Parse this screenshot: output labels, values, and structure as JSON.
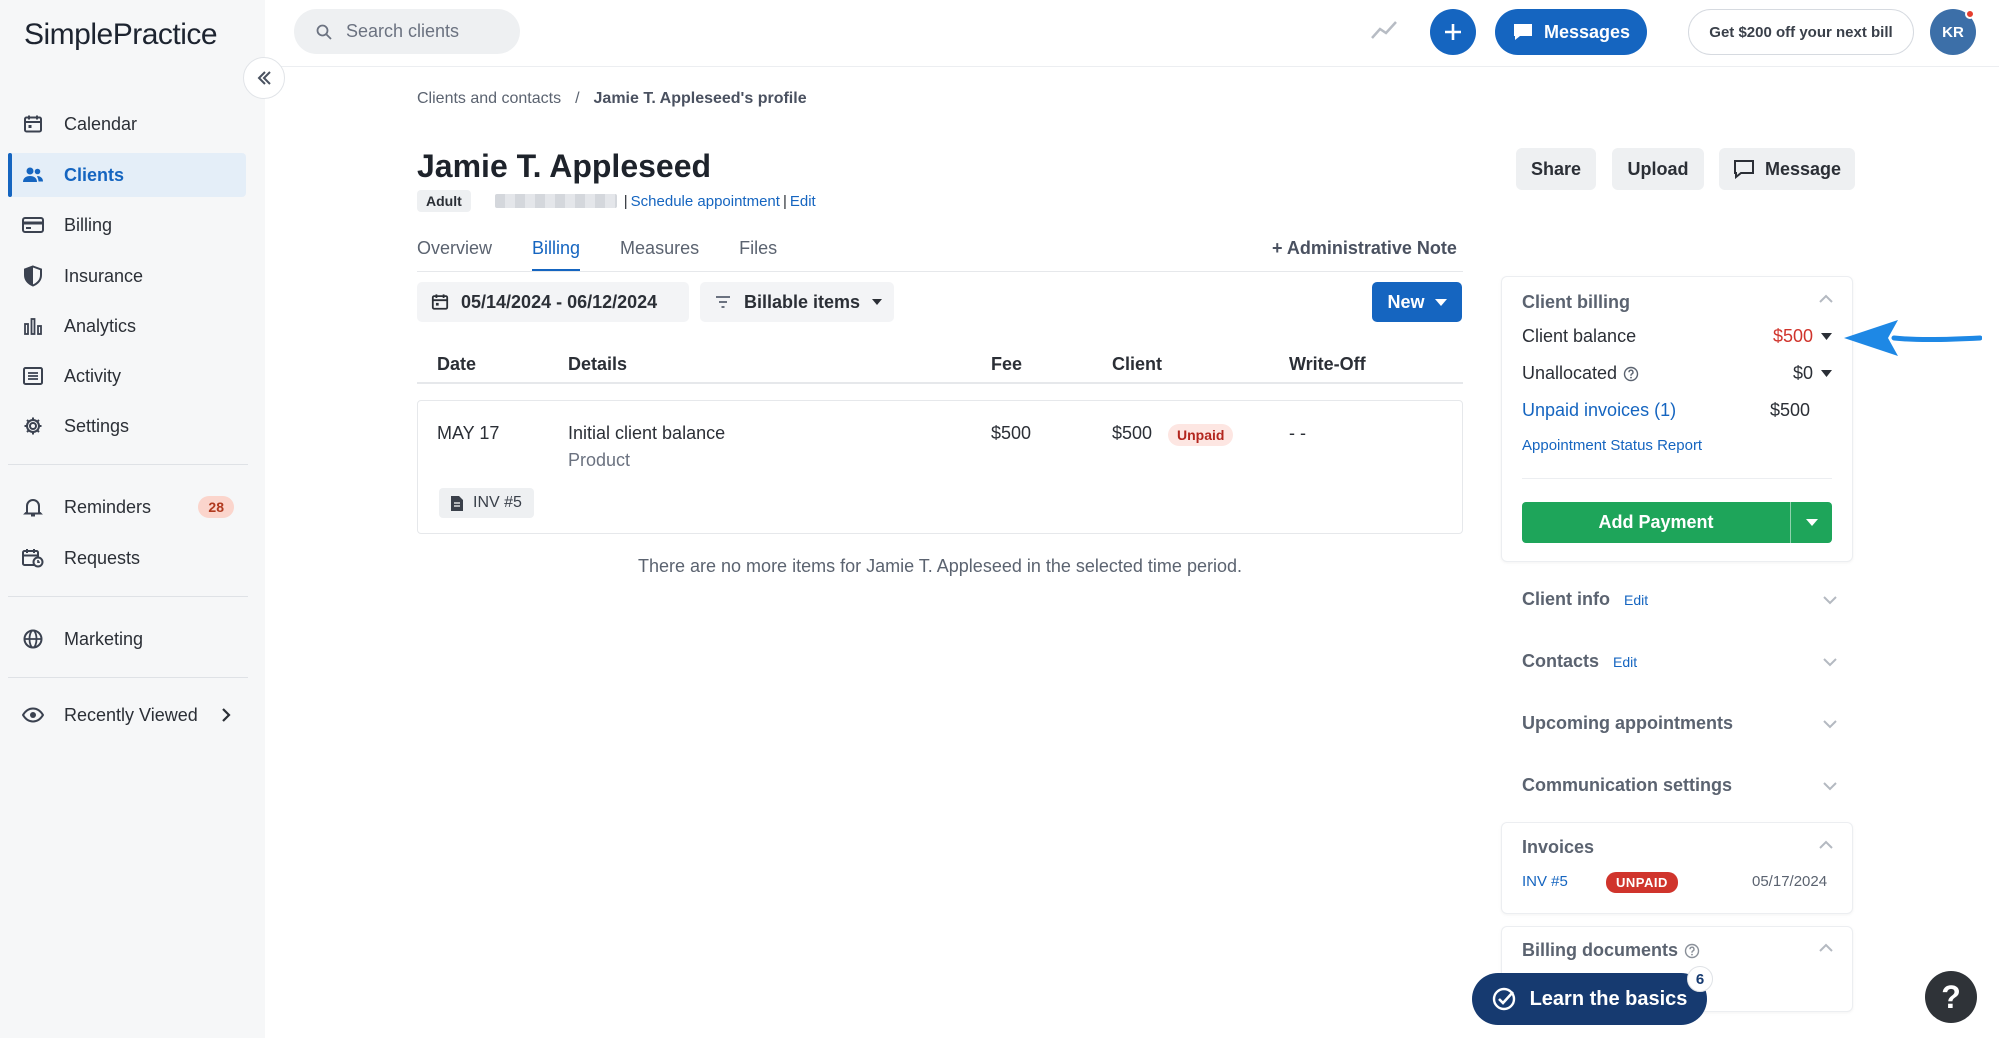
{
  "app": {
    "logo": "SimplePractice"
  },
  "sidebar": {
    "items": [
      {
        "label": "Calendar",
        "icon": "calendar-icon"
      },
      {
        "label": "Clients",
        "icon": "users-icon"
      },
      {
        "label": "Billing",
        "icon": "credit-card-icon"
      },
      {
        "label": "Insurance",
        "icon": "shield-icon"
      },
      {
        "label": "Analytics",
        "icon": "bar-chart-icon"
      },
      {
        "label": "Activity",
        "icon": "list-icon"
      },
      {
        "label": "Settings",
        "icon": "gear-icon"
      },
      {
        "label": "Reminders",
        "icon": "bell-icon",
        "badge": "28"
      },
      {
        "label": "Requests",
        "icon": "calendar-clock-icon"
      },
      {
        "label": "Marketing",
        "icon": "globe-icon"
      },
      {
        "label": "Recently Viewed",
        "icon": "eye-icon"
      }
    ],
    "active": "Clients"
  },
  "topbar": {
    "search_placeholder": "Search clients",
    "messages_label": "Messages",
    "promo_label": "Get $200 off your next bill",
    "avatar_initials": "KR"
  },
  "breadcrumb": {
    "parent": "Clients and contacts",
    "separator": "/",
    "current": "Jamie T. Appleseed's profile"
  },
  "client": {
    "name": "Jamie T. Appleseed",
    "tag": "Adult",
    "schedule_link": "Schedule appointment",
    "edit_link": "Edit",
    "sep": "|"
  },
  "header_buttons": {
    "share": "Share",
    "upload": "Upload",
    "message": "Message"
  },
  "tabs": [
    {
      "label": "Overview"
    },
    {
      "label": "Billing",
      "active": true
    },
    {
      "label": "Measures"
    },
    {
      "label": "Files"
    }
  ],
  "admin_note": "+ Administrative Note",
  "filters": {
    "date_range": "05/14/2024 - 06/12/2024",
    "type": "Billable items",
    "new_label": "New"
  },
  "table": {
    "headers": {
      "date": "Date",
      "details": "Details",
      "fee": "Fee",
      "client": "Client",
      "writeoff": "Write-Off"
    },
    "rows": [
      {
        "date": "MAY 17",
        "details": "Initial client balance",
        "subdetail": "Product",
        "fee": "$500",
        "client": "$500",
        "status": "Unpaid",
        "writeoff": "- -",
        "invoice": "INV #5"
      }
    ],
    "empty_message": "There are no more items for Jamie T. Appleseed in the selected time period."
  },
  "client_billing": {
    "title": "Client billing",
    "balance_label": "Client balance",
    "balance_value": "$500",
    "unallocated_label": "Unallocated",
    "unallocated_value": "$0",
    "unpaid_label": "Unpaid invoices (1)",
    "unpaid_value": "$500",
    "status_report": "Appointment Status Report",
    "add_payment": "Add Payment"
  },
  "sections": {
    "client_info": "Client info",
    "contacts": "Contacts",
    "edit": "Edit",
    "upcoming": "Upcoming appointments",
    "communication": "Communication settings"
  },
  "invoices": {
    "title": "Invoices",
    "number": "INV #5",
    "status": "UNPAID",
    "date": "05/17/2024"
  },
  "billing_documents": {
    "title": "Billing documents"
  },
  "learn": {
    "label": "Learn the basics",
    "count": "6"
  },
  "help": {
    "label": "?"
  },
  "colors": {
    "accent": "#1565c0",
    "success": "#1ea55a",
    "danger": "#d0342c"
  }
}
